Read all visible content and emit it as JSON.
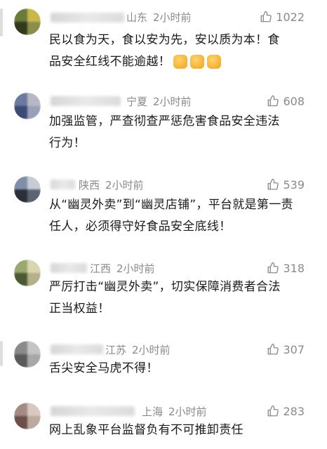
{
  "comments": [
    {
      "location": "山东",
      "time": "2小时前",
      "likes": "1022",
      "text_lines": [
        "民以食为天，食以安为先，安以质为本！食",
        "品安全红线不能逾越！"
      ],
      "reaction_emoji": [
        "fist-emoji",
        "fist-emoji",
        "fist-emoji"
      ]
    },
    {
      "location": "宁夏",
      "time": "2小时前",
      "likes": "608",
      "text_lines": [
        "加强监管，严查彻查严惩危害食品安全违法",
        "行为！"
      ]
    },
    {
      "location": "陕西",
      "time": "2小时前",
      "likes": "539",
      "text_lines": [
        "从“幽灵外卖”到“幽灵店铺”，平台就是第一责",
        "任人，必须得守好食品安全底线！"
      ]
    },
    {
      "location": "江西",
      "time": "2小时前",
      "likes": "318",
      "text_lines": [
        "严厉打击“幽灵外卖”，切实保障消费者合法",
        "正当权益！"
      ]
    },
    {
      "location": "江苏",
      "time": "2小时前",
      "likes": "307",
      "text_lines": [
        "舌尖安全马虎不得！"
      ]
    },
    {
      "location": "上海",
      "time": "2小时前",
      "likes": "283",
      "text_lines": [
        "网上乱象平台监督负有不可推卸责任"
      ]
    }
  ],
  "icons": {
    "like": "thumbs-up-icon"
  },
  "colors": {
    "meta_text": "#8a8a8a",
    "body_text": "#1a1a1a"
  }
}
